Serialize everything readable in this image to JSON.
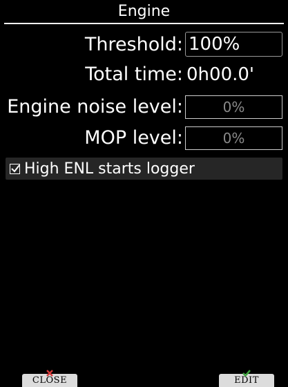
{
  "window": {
    "title": "Engine"
  },
  "fields": {
    "threshold": {
      "label": "Threshold:",
      "value": "100%"
    },
    "total_time": {
      "label": "Total time:",
      "value": "0h00.0'"
    },
    "engine_noise": {
      "label": "Engine noise level:",
      "value": "0%"
    },
    "mop": {
      "label": "MOP level:",
      "value": "0%"
    }
  },
  "options": {
    "high_enl": {
      "label": "High ENL starts logger",
      "checked": true
    }
  },
  "softkeys": {
    "close": {
      "label": "CLOSE",
      "icon": "x-icon",
      "icon_color": "#d63a3a"
    },
    "edit": {
      "label": "EDIT",
      "icon": "check-icon",
      "icon_color": "#3ea53e"
    }
  }
}
